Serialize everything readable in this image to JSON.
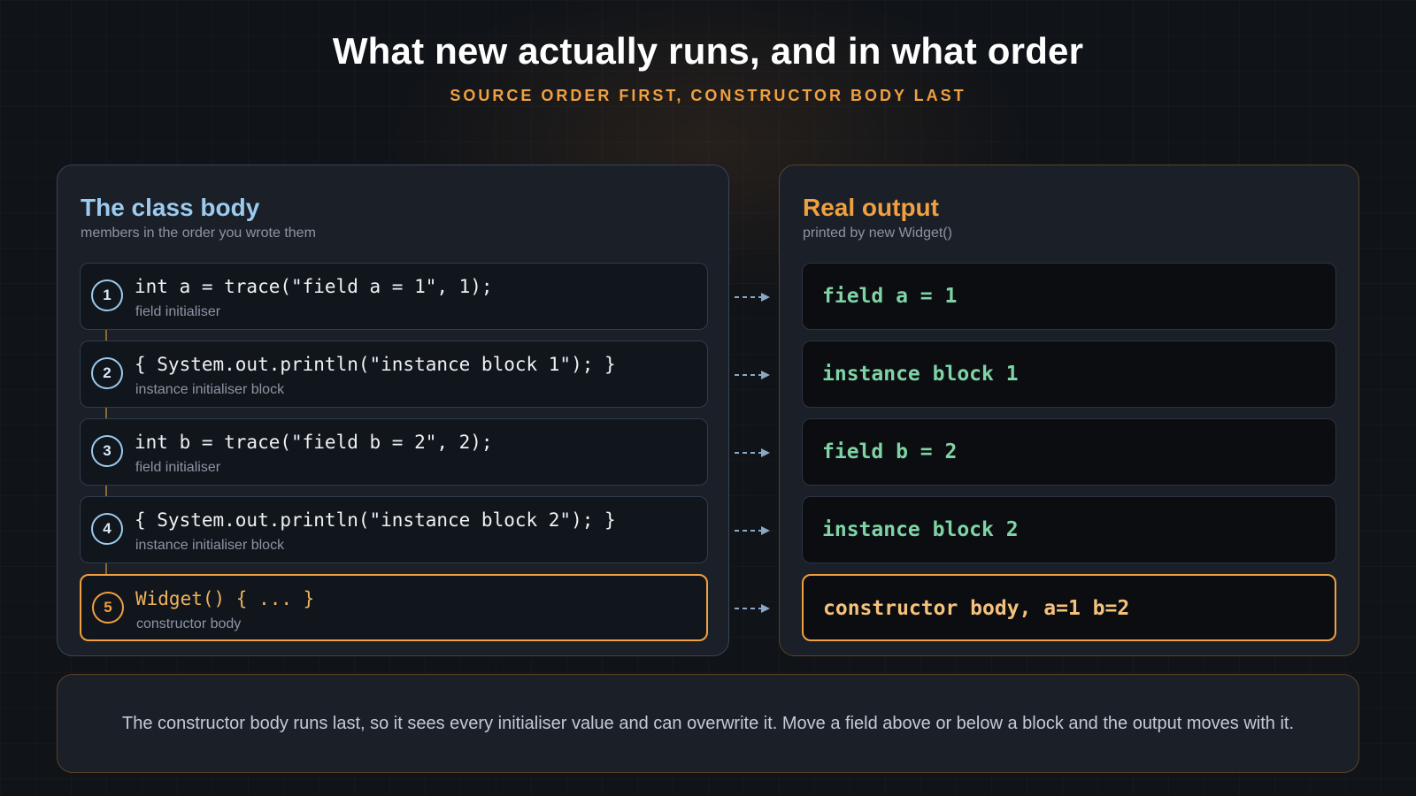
{
  "header": {
    "title": "What new actually runs, and in what order",
    "subtitle": "SOURCE ORDER FIRST, CONSTRUCTOR BODY LAST"
  },
  "left_panel": {
    "title": "The class body",
    "subtitle": "members in the order you wrote them",
    "steps": [
      {
        "num": "1",
        "code": "int a = trace(\"field a = 1\", 1);",
        "desc": "field initialiser"
      },
      {
        "num": "2",
        "code": "{ System.out.println(\"instance block 1\"); }",
        "desc": "instance initialiser block"
      },
      {
        "num": "3",
        "code": "int b = trace(\"field b = 2\", 2);",
        "desc": "field initialiser"
      },
      {
        "num": "4",
        "code": "{ System.out.println(\"instance block 2\"); }",
        "desc": "instance initialiser block"
      },
      {
        "num": "5",
        "code": "Widget() { ... }",
        "desc": "constructor body"
      }
    ]
  },
  "right_panel": {
    "title": "Real output",
    "subtitle": "printed by new Widget()",
    "lines": [
      "field a = 1",
      "instance block 1",
      "field b = 2",
      "instance block 2",
      "constructor body, a=1 b=2"
    ]
  },
  "note": "The constructor body runs last, so it sees every initialiser value and can overwrite it. Move a field above or below a block and the output moves with it.",
  "colors": {
    "accent": "#f0a040",
    "blue": "#9ccbf0",
    "green": "#7fd4a6",
    "background": "#101318"
  }
}
